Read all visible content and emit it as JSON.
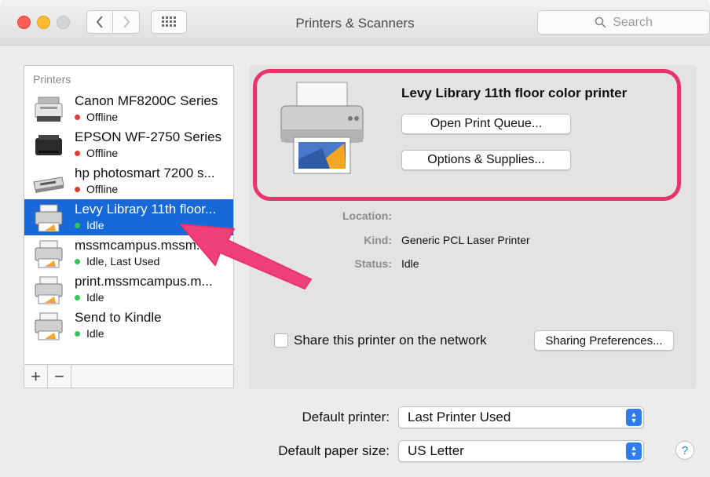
{
  "window": {
    "title": "Printers & Scanners",
    "search_placeholder": "Search"
  },
  "printers": {
    "header": "Printers",
    "items": [
      {
        "name": "Canon MF8200C Series",
        "status": "Offline",
        "status_color": "#e53935",
        "icon": "mfp-printer-icon"
      },
      {
        "name": "EPSON WF-2750 Series",
        "status": "Offline",
        "status_color": "#e53935",
        "icon": "inkjet-printer-icon"
      },
      {
        "name": "hp photosmart 7200 s...",
        "status": "Offline",
        "status_color": "#e53935",
        "icon": "photo-printer-icon"
      },
      {
        "name": "Levy Library 11th floor...",
        "status": "Idle",
        "status_color": "#34c759",
        "icon": "generic-printer-icon",
        "selected": true
      },
      {
        "name": "mssmcampus.mssm...",
        "status": "Idle, Last Used",
        "status_color": "#34c759",
        "icon": "generic-printer-icon"
      },
      {
        "name": "print.mssmcampus.m...",
        "status": "Idle",
        "status_color": "#34c759",
        "icon": "generic-printer-icon"
      },
      {
        "name": "Send to Kindle",
        "status": "Idle",
        "status_color": "#34c759",
        "icon": "generic-printer-icon"
      }
    ],
    "add_label": "+",
    "remove_label": "−"
  },
  "detail": {
    "printer_name": "Levy Library 11th floor color printer",
    "open_queue_label": "Open Print Queue...",
    "options_label": "Options & Supplies...",
    "location_label": "Location:",
    "location_value": "",
    "kind_label": "Kind:",
    "kind_value": "Generic PCL Laser Printer",
    "status_label": "Status:",
    "status_value": "Idle",
    "share_label": "Share this printer on the network",
    "share_checked": false,
    "sharing_prefs_label": "Sharing Preferences..."
  },
  "defaults": {
    "printer_label": "Default printer:",
    "printer_value": "Last Printer Used",
    "paper_label": "Default paper size:",
    "paper_value": "US Letter"
  },
  "help_label": "?",
  "colors": {
    "selection": "#1768d8",
    "annotation": "#e8336b",
    "offline": "#e53935",
    "idle": "#34c759"
  }
}
